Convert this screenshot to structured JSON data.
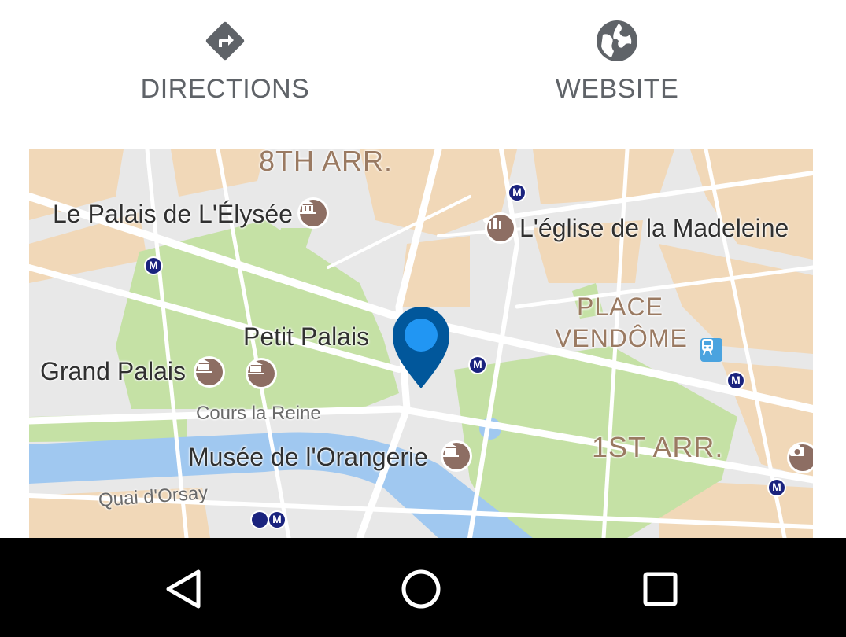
{
  "actions": {
    "directions": {
      "label": "DIRECTIONS",
      "icon": "directions-icon"
    },
    "website": {
      "label": "WEBSITE",
      "icon": "globe-icon"
    }
  },
  "map": {
    "districts": {
      "eighth": "8TH ARR.",
      "first": "1ST ARR.",
      "place_vendome_1": "PLACE",
      "place_vendome_2": "VENDÔME"
    },
    "places": {
      "elysee": "Le Palais de L'Élysée",
      "madeleine": "L'église de la Madeleine",
      "petit_palais": "Petit Palais",
      "grand_palais": "Grand Palais",
      "orangerie": "Musée de l'Orangerie"
    },
    "streets": {
      "cours_la_reine": "Cours la Reine",
      "quai_dorsay": "Quai d'Orsay"
    },
    "metro_label": "M",
    "colors": {
      "park": "#c5e1a5",
      "water": "#a0c8f0",
      "buildings": "#f1d8b8",
      "road": "#ffffff",
      "pin_outer": "#01579b",
      "pin_inner": "#2196f3",
      "poi": "#8d6e63",
      "metro": "#1a237e"
    }
  },
  "navbar": {
    "back": "back-icon",
    "home": "home-icon",
    "recents": "recents-icon"
  }
}
